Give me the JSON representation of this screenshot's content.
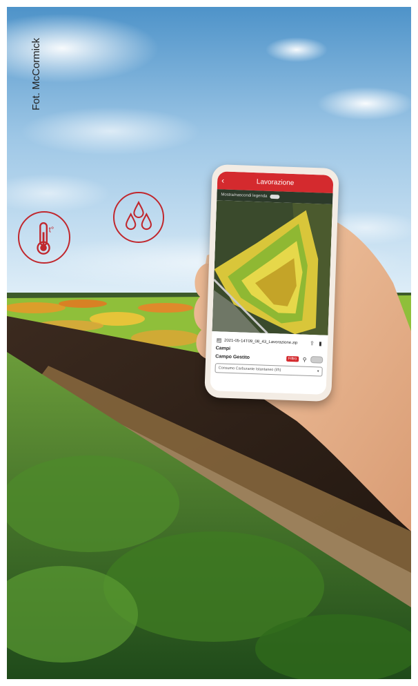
{
  "photo_credit": "Fot. McCormick",
  "icons": {
    "temperature": "thermometer-icon",
    "humidity": "water-drops-icon"
  },
  "phone": {
    "header_title": "Lavorazione",
    "back_icon": "chevron-left-icon",
    "toggle_label": "Mostra/nascondi legenda",
    "file_name": "2021-05-14T09_08_43_Lavorazione.zip",
    "section_label": "Campi",
    "field_label": "Campo Gestito",
    "badge": "Filtro",
    "select_value": "Consumo Carburante Istantaneo (l/h)"
  },
  "colors": {
    "accent": "#d42a2e",
    "icon_stroke": "#c0272d"
  }
}
